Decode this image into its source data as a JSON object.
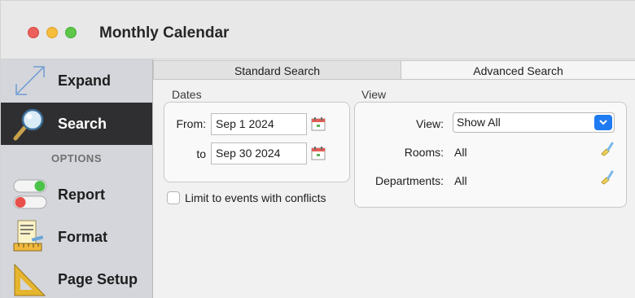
{
  "window": {
    "title": "Monthly Calendar"
  },
  "sidebar": {
    "items": [
      {
        "label": "Expand",
        "icon": "expand-icon"
      },
      {
        "label": "Search",
        "icon": "magnifier-icon"
      },
      {
        "label": "Report",
        "icon": "toggle-switches-icon"
      },
      {
        "label": "Format",
        "icon": "ruler-pencil-icon"
      },
      {
        "label": "Page Setup",
        "icon": "set-square-icon"
      }
    ],
    "options_header": "OPTIONS"
  },
  "tabs": [
    {
      "label": "Standard Search",
      "selected": true
    },
    {
      "label": "Advanced Search",
      "selected": false
    }
  ],
  "dates": {
    "title": "Dates",
    "from_label": "From:",
    "from_value": "Sep 1 2024",
    "to_label": "to",
    "to_value": "Sep 30 2024"
  },
  "view": {
    "title": "View",
    "view_label": "View:",
    "view_value": "Show All",
    "rooms_label": "Rooms:",
    "rooms_value": "All",
    "departments_label": "Departments:",
    "departments_value": "All"
  },
  "conflicts": {
    "label": "Limit to events with conflicts",
    "checked": false
  },
  "colors": {
    "accent": "#1f7bf2",
    "sidebar_active": "#2f2f31",
    "sidebar_bg": "#d4d6db"
  }
}
